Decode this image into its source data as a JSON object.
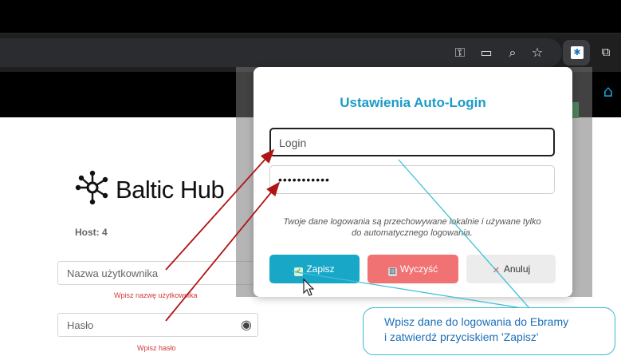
{
  "browser": {
    "icons": [
      "key-icon",
      "install-icon",
      "zoom-icon",
      "star-icon",
      "extension-icon",
      "puzzle-icon"
    ]
  },
  "page": {
    "brand": "Baltic Hub",
    "host": "Host: 4",
    "username_placeholder": "Nazwa użytkownika",
    "username_hint": "Wpisz nazwę użytkownika",
    "password_placeholder": "Hasło",
    "password_hint": "Wpisz hasło"
  },
  "modal": {
    "title": "Ustawienia Auto-Login",
    "login_placeholder": "Login",
    "password_value": "•••••••••••",
    "note_line1": "Twoje dane logowania są przechowywane lokalnie i używane tylko",
    "note_line2": "do automatycznego logowania.",
    "save_label": "Zapisz",
    "clear_label": "Wyczyść",
    "cancel_label": "Anuluj"
  },
  "callout": {
    "line1": "Wpisz dane do logowania do Ebramy",
    "line2": "i zatwierdź przyciskiem 'Zapisz'"
  },
  "colors": {
    "accent": "#1a9bc7",
    "save": "#19a7c8",
    "clear": "#f17272",
    "hint": "#d23a3a",
    "arrow": "#b01515"
  }
}
